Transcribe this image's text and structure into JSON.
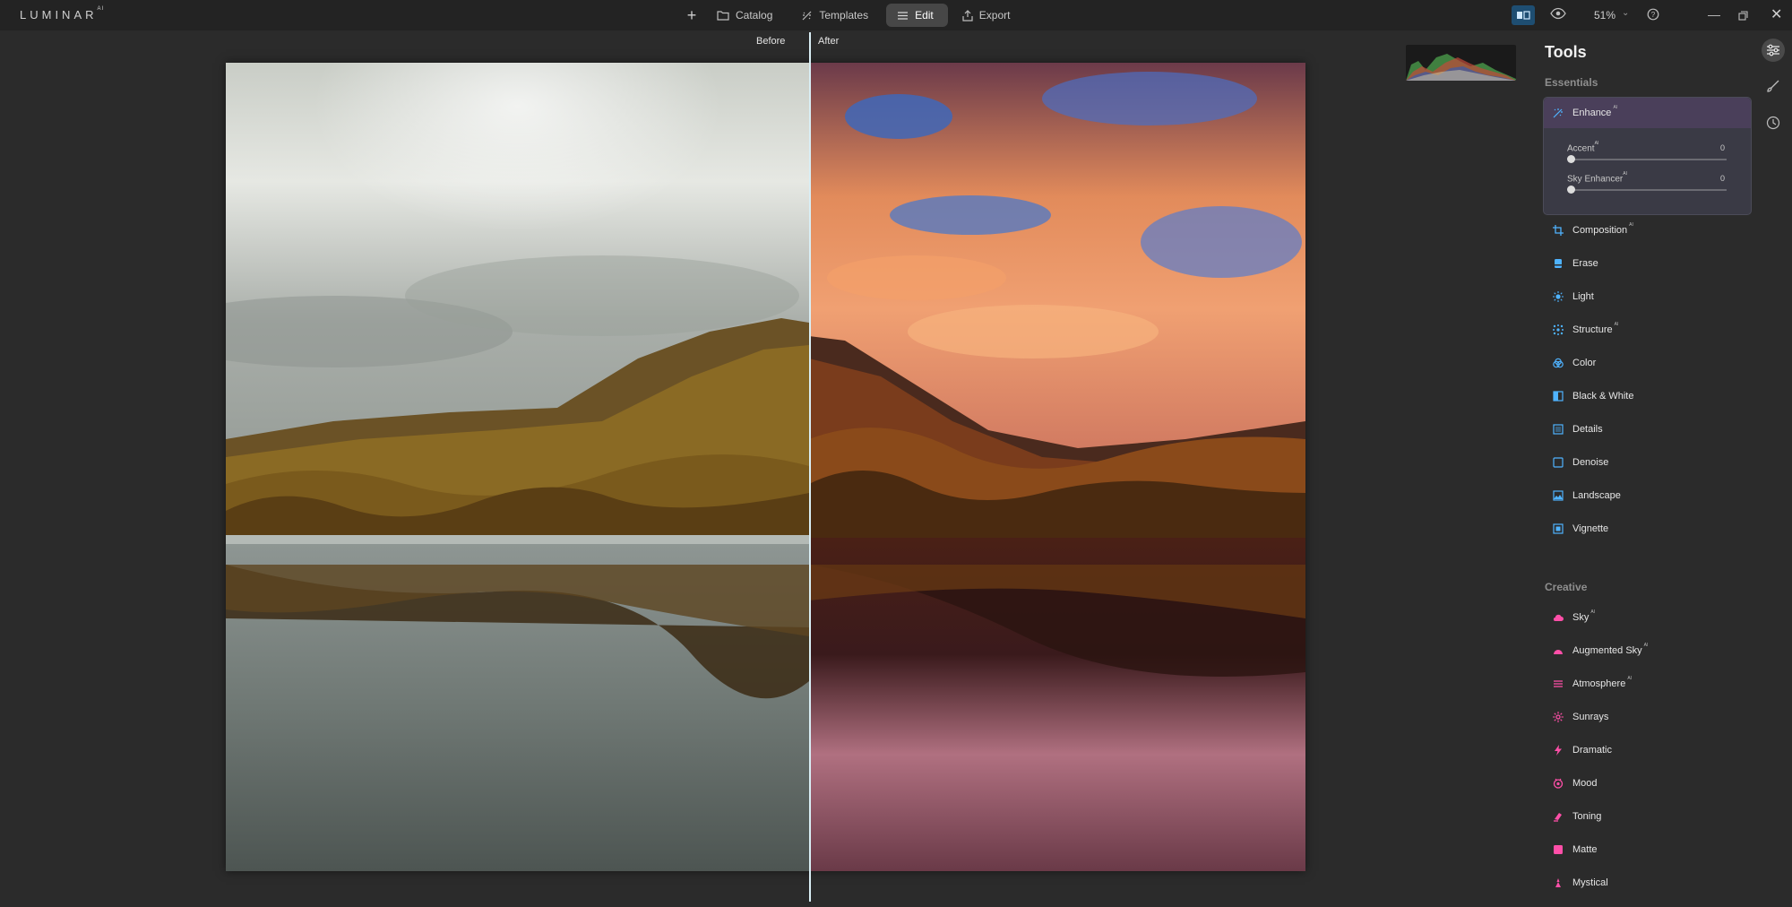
{
  "app": {
    "logo_text": "LUMINAR",
    "logo_sup": "AI"
  },
  "nav": {
    "plus": "+",
    "items": [
      {
        "label": "Catalog",
        "icon": "folder-icon"
      },
      {
        "label": "Templates",
        "icon": "templates-icon"
      },
      {
        "label": "Edit",
        "icon": "edit-sliders-icon",
        "active": true
      },
      {
        "label": "Export",
        "icon": "export-icon"
      }
    ]
  },
  "topright": {
    "zoom": "51%",
    "zoom_chevron": "⌄",
    "minimize": "—",
    "close": "✕"
  },
  "canvas": {
    "before_label": "Before",
    "after_label": "After"
  },
  "panel": {
    "title": "Tools",
    "essentials_label": "Essentials",
    "creative_label": "Creative",
    "enhance": {
      "label": "Enhance",
      "sup": "AI",
      "sliders": [
        {
          "label": "Accent",
          "sup": "AI",
          "value": "0",
          "level": 0
        },
        {
          "label": "Sky Enhancer",
          "sup": "AI",
          "value": "0",
          "level": 0
        }
      ]
    },
    "essentials": [
      {
        "label": "Composition",
        "sup": "AI",
        "icon": "crop-icon"
      },
      {
        "label": "Erase",
        "sup": "",
        "icon": "eraser-icon"
      },
      {
        "label": "Light",
        "sup": "",
        "icon": "sun-icon"
      },
      {
        "label": "Structure",
        "sup": "AI",
        "icon": "structure-icon"
      },
      {
        "label": "Color",
        "sup": "",
        "icon": "color-icon"
      },
      {
        "label": "Black & White",
        "sup": "",
        "icon": "bw-icon"
      },
      {
        "label": "Details",
        "sup": "",
        "icon": "details-icon"
      },
      {
        "label": "Denoise",
        "sup": "",
        "icon": "denoise-icon"
      },
      {
        "label": "Landscape",
        "sup": "",
        "icon": "landscape-icon"
      },
      {
        "label": "Vignette",
        "sup": "",
        "icon": "vignette-icon"
      }
    ],
    "creative": [
      {
        "label": "Sky",
        "sup": "AI",
        "icon": "cloud-icon"
      },
      {
        "label": "Augmented Sky",
        "sup": "AI",
        "icon": "augmented-sky-icon"
      },
      {
        "label": "Atmosphere",
        "sup": "AI",
        "icon": "atmosphere-icon"
      },
      {
        "label": "Sunrays",
        "sup": "",
        "icon": "sunrays-icon"
      },
      {
        "label": "Dramatic",
        "sup": "",
        "icon": "lightning-icon"
      },
      {
        "label": "Mood",
        "sup": "",
        "icon": "mood-icon"
      },
      {
        "label": "Toning",
        "sup": "",
        "icon": "toning-icon"
      },
      {
        "label": "Matte",
        "sup": "",
        "icon": "matte-icon"
      },
      {
        "label": "Mystical",
        "sup": "",
        "icon": "mystical-icon"
      }
    ]
  },
  "colors": {
    "essentials_icon": "#4fb3ff",
    "creative_icon": "#ff4fa8",
    "compare_active": "#1e4e72",
    "divider": "#d9eef5"
  }
}
